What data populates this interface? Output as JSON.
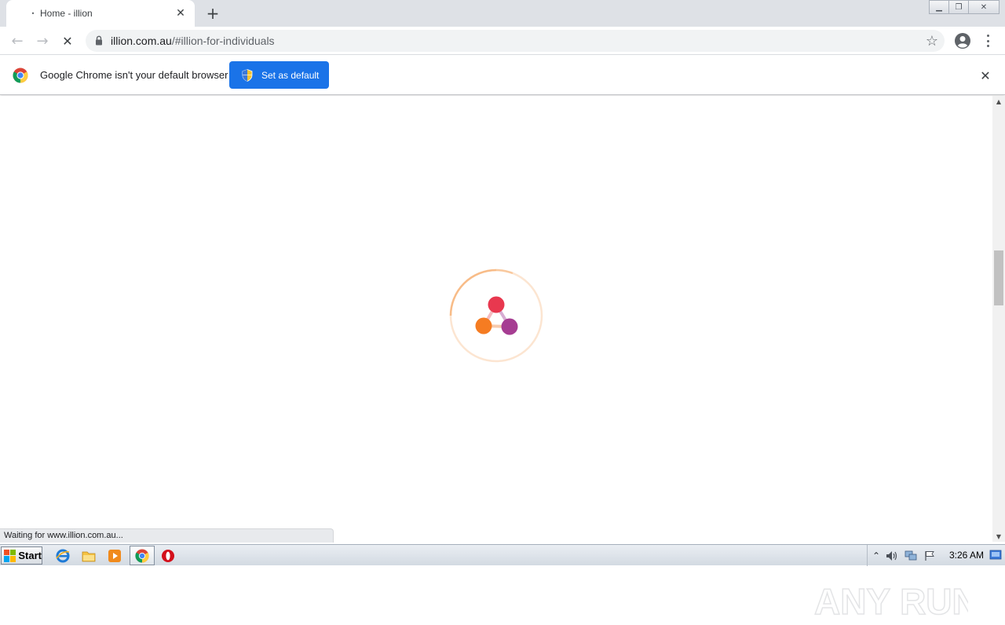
{
  "tab": {
    "title": "Home - illion",
    "close_glyph": "✕",
    "favicon_glyph": "•"
  },
  "new_tab_glyph": "+",
  "window_controls": {
    "minimize": "▁",
    "restore": "❐",
    "close": "✕"
  },
  "toolbar": {
    "back_glyph": "←",
    "forward_glyph": "→",
    "stop_glyph": "✕",
    "url_host": "illion.com.au",
    "url_path": "/#illion-for-individuals",
    "bookmark_glyph": "☆"
  },
  "infobar": {
    "message": "Google Chrome isn't your default browser",
    "button_label": "Set as default",
    "close_glyph": "✕"
  },
  "status": {
    "text": "Waiting for www.illion.com.au..."
  },
  "watermark": {
    "text": "ANY RUN"
  },
  "taskbar": {
    "start_label": "Start",
    "clock": "3:26 AM",
    "tray_up_glyph": "⌃"
  },
  "colors": {
    "accent_blue": "#1a73e8",
    "loader_red": "#e8384f",
    "loader_orange": "#f57c22",
    "loader_purple": "#a63d92",
    "loader_ring": "#f7b57b"
  },
  "icons": {
    "lock": "lock-icon",
    "profile": "account-circle-icon",
    "chrome": "chrome-logo-icon",
    "shield": "uac-shield-icon"
  }
}
